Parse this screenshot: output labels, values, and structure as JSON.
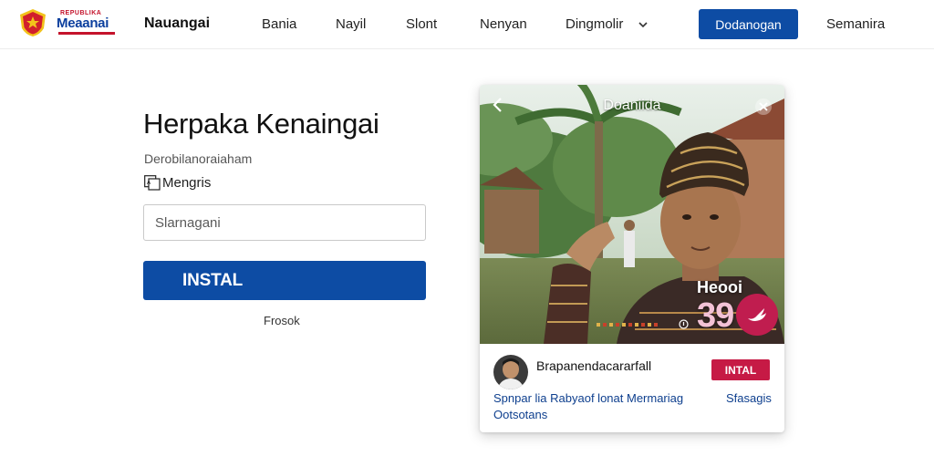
{
  "header": {
    "logo_small": "REPUBLIKA",
    "logo_big": "Meaanai",
    "brand_name": "Nauangai",
    "nav": [
      {
        "label": "Bania"
      },
      {
        "label": "Nayil"
      },
      {
        "label": "Slont"
      },
      {
        "label": "Nenyan"
      }
    ],
    "dropdown_label": "Dingmolir",
    "cta_label": "Dodanogan",
    "right_link": "Semanira"
  },
  "form": {
    "title": "Herpaka Kenaingai",
    "subtitle": "Derobilanoraiaham",
    "language_label": "Mengris",
    "search_placeholder": "Slarnagani",
    "install_label": "INSTAL",
    "link_below": "Frosok"
  },
  "card": {
    "photo_title": "Doaniida",
    "photo_badge": "Heooi",
    "photo_number": "39",
    "author_name": "Brapanendacararfall",
    "install_label": "INTAL",
    "link_primary": "Spnpar lia Rabyaof lonat Mermariag",
    "link_secondary": "Ootsotans",
    "link_right": "Sfasagis"
  },
  "icons": {
    "logo": "garuda-shield-icon",
    "dropdown": "chevron-down-icon",
    "language": "language-toggle-icon",
    "back": "back-arrow-icon",
    "close": "close-icon",
    "share": "bird-icon"
  },
  "colors": {
    "primary": "#0d4ca4",
    "accent": "#c61a45"
  }
}
